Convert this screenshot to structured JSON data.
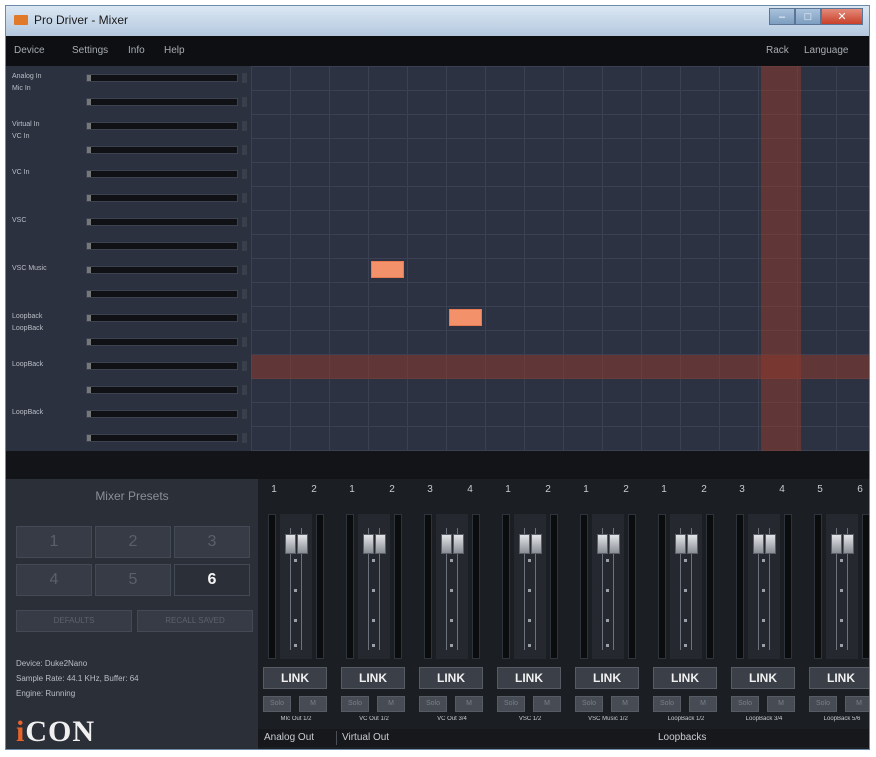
{
  "window": {
    "title": "Pro Driver - Mixer",
    "controls": {
      "minimize": "–",
      "maximize": "□",
      "close": "✕"
    }
  },
  "menu": {
    "left": [
      "Device",
      "Settings",
      "Info",
      "Help"
    ],
    "right": [
      "Rack",
      "Language"
    ]
  },
  "rows": [
    {
      "label": "Analog In",
      "label2": "Mic In"
    },
    {
      "label": "Virtual In",
      "label2": "VC In"
    },
    {
      "label": "VC In"
    },
    {
      "label": "VSC"
    },
    {
      "label": "VSC Music"
    },
    {
      "label": "Loopback",
      "label2": "LoopBack"
    },
    {
      "label": "LoopBack"
    },
    {
      "label": "LoopBack"
    }
  ],
  "active_cells": [
    {
      "row": 8,
      "col": 3
    },
    {
      "row": 10,
      "col": 5
    }
  ],
  "highlight": {
    "row": 12,
    "col": 13
  },
  "presets": {
    "title": "Mixer Presets",
    "buttons": [
      "1",
      "2",
      "3",
      "4",
      "5",
      "6"
    ],
    "active": "6",
    "defaults_label": "DEFAULTS",
    "recall_label": "RECALL SAVED"
  },
  "device_info": {
    "device": "Device: Duke2Nano",
    "sample_rate": "Sample Rate: 44.1 KHz, Buffer: 64",
    "engine": "Engine: Running"
  },
  "logo": {
    "prefix": "i",
    "main": "CON"
  },
  "strips": [
    {
      "ch": [
        "1",
        "2"
      ],
      "link": "LINK",
      "solo": "Solo",
      "mute": "M",
      "name": "MIc Out 1/2"
    },
    {
      "ch": [
        "1",
        "2"
      ],
      "link": "LINK",
      "solo": "Solo",
      "mute": "M",
      "name": "VC Out 1/2"
    },
    {
      "ch": [
        "3",
        "4"
      ],
      "link": "LINK",
      "solo": "Solo",
      "mute": "M",
      "name": "VC Out 3/4"
    },
    {
      "ch": [
        "1",
        "2"
      ],
      "link": "LINK",
      "solo": "Solo",
      "mute": "M",
      "name": "VSC 1/2"
    },
    {
      "ch": [
        "1",
        "2"
      ],
      "link": "LINK",
      "solo": "Solo",
      "mute": "M",
      "name": "VSC Music 1/2"
    },
    {
      "ch": [
        "1",
        "2"
      ],
      "link": "LINK",
      "solo": "Solo",
      "mute": "M",
      "name": "LoopBack 1/2"
    },
    {
      "ch": [
        "3",
        "4"
      ],
      "link": "LINK",
      "solo": "Solo",
      "mute": "M",
      "name": "LoopBack 3/4"
    },
    {
      "ch": [
        "5",
        "6"
      ],
      "link": "LINK",
      "solo": "Solo",
      "mute": "M",
      "name": "LoopBack 5/6"
    }
  ],
  "groups": [
    "Analog Out",
    "Virtual Out",
    "Loopbacks"
  ],
  "colors": {
    "accent": "#f2916a",
    "highlight": "#8c3a2e",
    "logo_accent": "#e8632a"
  }
}
